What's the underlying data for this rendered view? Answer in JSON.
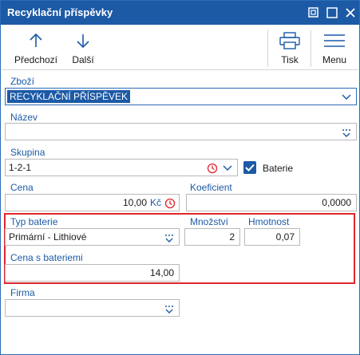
{
  "window": {
    "title": "Recyklační příspěvky"
  },
  "toolbar": {
    "prev_label": "Předchozí",
    "next_label": "Další",
    "print_label": "Tisk",
    "menu_label": "Menu"
  },
  "form": {
    "zbozi": {
      "label": "Zboží",
      "value": "RECYKLAČNÍ PŘÍSPĚVEK"
    },
    "nazev": {
      "label": "Název",
      "value": ""
    },
    "skupina": {
      "label": "Skupina",
      "value": "1-2-1"
    },
    "baterie": {
      "label": "Baterie",
      "checked": true
    },
    "cena": {
      "label": "Cena",
      "value": "10,00",
      "currency": "Kč"
    },
    "koeficient": {
      "label": "Koeficient",
      "value": "0,0000"
    },
    "typ_baterie": {
      "label": "Typ baterie",
      "value": "Primární - Lithiové"
    },
    "mnozstvi": {
      "label": "Množství",
      "value": "2"
    },
    "hmotnost": {
      "label": "Hmotnost",
      "value": "0,07"
    },
    "cena_s_bateriemi": {
      "label": "Cena s bateriemi",
      "value": "14,00"
    },
    "firma": {
      "label": "Firma",
      "value": ""
    }
  },
  "colors": {
    "accent": "#1c5aa6",
    "highlight_border": "#e0262e"
  }
}
